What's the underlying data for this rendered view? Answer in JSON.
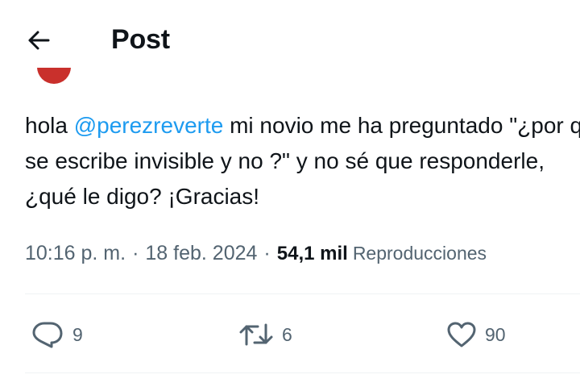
{
  "header": {
    "title": "Post",
    "back_icon": "arrow-left-icon"
  },
  "tweet": {
    "lines": [
      {
        "before": "hola ",
        "mention": "@perezreverte",
        "after": " mi novio me ha preguntado \"¿por qué"
      },
      {
        "text": "se escribe invisible y no    ?\" y no sé que responderle,"
      },
      {
        "text": "¿qué le digo? ¡Gracias!"
      }
    ],
    "time": "10:16 p. m.",
    "separator": "·",
    "date": "18 feb. 2024",
    "views_count": "54,1 mil",
    "views_label": "Reproducciones"
  },
  "actions": [
    {
      "icon": "reply-icon",
      "count": "9"
    },
    {
      "icon": "repost-icon",
      "count": "6"
    },
    {
      "icon": "like-icon",
      "count": "90"
    }
  ],
  "colors": {
    "text": "#0f1419",
    "secondary": "#536471",
    "link": "#1d9bf0",
    "avatar": "#c9302c",
    "divider": "#eff3f4"
  }
}
